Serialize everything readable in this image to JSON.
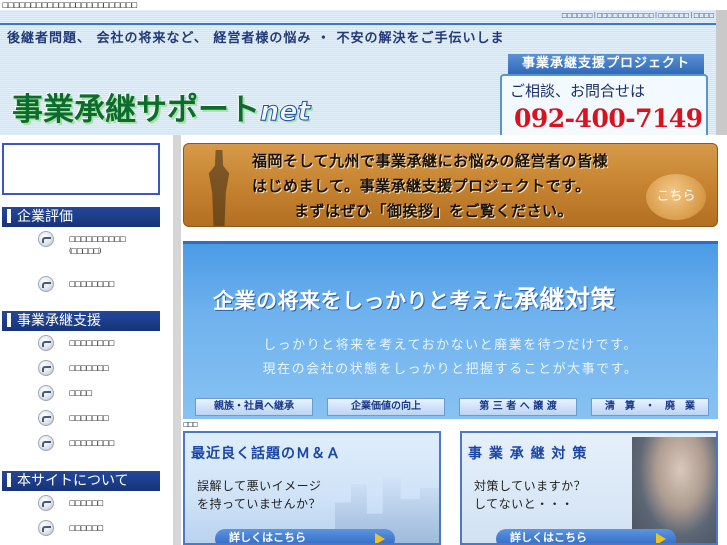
{
  "top_strip": {
    "tofu": "□□□□□□□□□□□□□□□□□□□□□□□□"
  },
  "header": {
    "nav": "□□□□□□ | □□□□□□□□□□□ | □□□□□□ | □□□□",
    "tagline": "後継者問題、 会社の将来など、 経営者様の悩み ・ 不安の解決をご手伝いしま",
    "logo_main": "事業承継サポート",
    "logo_suffix": "net",
    "contact_label": "事業承継支援プロジェクト",
    "contact_sub": "ご相談、お問合せは",
    "phone": "092-400-7149"
  },
  "sidebar": {
    "sections": [
      {
        "title": "企業評価",
        "items": [
          {
            "label": "□□□□□□□□□□",
            "sub": "(□□□□□)"
          },
          {
            "label": "□□□□□□□□"
          }
        ]
      },
      {
        "title": "事業承継支援",
        "items": [
          {
            "label": "□□□□□□□□"
          },
          {
            "label": "□□□□□□□"
          },
          {
            "label": "□□□□"
          },
          {
            "label": "□□□□□□□"
          },
          {
            "label": "□□□□□□□□"
          }
        ]
      },
      {
        "title": "本サイトについて",
        "items": [
          {
            "label": "□□□□□□"
          },
          {
            "label": "□□□□□□"
          }
        ]
      }
    ]
  },
  "banner_greeting": {
    "lines": [
      "福岡そして九州で事業承継にお悩みの経営者の皆様",
      "はじめまして。事業承継支援プロジェクトです。",
      "まずはぜひ「御挨拶」をご覧ください。"
    ],
    "button": "こちら"
  },
  "banner_strategy": {
    "title_prefix": "企業の将来をしっかりと考えた",
    "title_emph": "承継対策",
    "sub1": "しっかりと将来を考えておかないと廃業を待つだけです。",
    "sub2": "現在の会社の状態をしっかりと把握することが大事です。",
    "buttons": [
      "親族・社員へ継承",
      "企業価値の向上",
      "第 三 者 へ 譲 渡",
      "清　算　・　廃　業"
    ]
  },
  "small_tofu": "□□□",
  "card_ma": {
    "title": "最近良く話題のＭ＆Ａ",
    "line1": "誤解して悪いイメージ",
    "line2": "を持っていませんか？",
    "button": "詳しくはこちら"
  },
  "card_measures": {
    "title": "事 業 承 継 対 策",
    "line1": "対策していますか？",
    "line2": "してないと・・・",
    "button": "詳しくはこちら"
  }
}
